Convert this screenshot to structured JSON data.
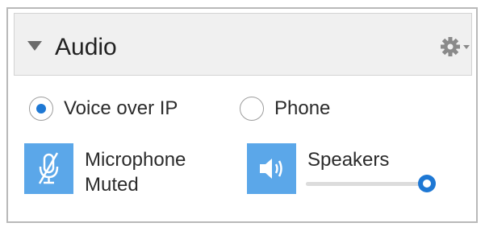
{
  "panel": {
    "title": "Audio",
    "icons": {
      "collapse": "triangle-down-icon",
      "settings": "gear-icon"
    }
  },
  "connection": {
    "options": [
      {
        "label": "Voice over IP",
        "selected": true
      },
      {
        "label": "Phone",
        "selected": false
      }
    ]
  },
  "microphone": {
    "label_line1": "Microphone",
    "label_line2": "Muted",
    "icon": "microphone-muted-icon"
  },
  "speakers": {
    "label": "Speakers",
    "icon": "speaker-icon",
    "volume": 1.0
  },
  "colors": {
    "accent": "#1e78d4",
    "tile": "#5ba7e9"
  }
}
